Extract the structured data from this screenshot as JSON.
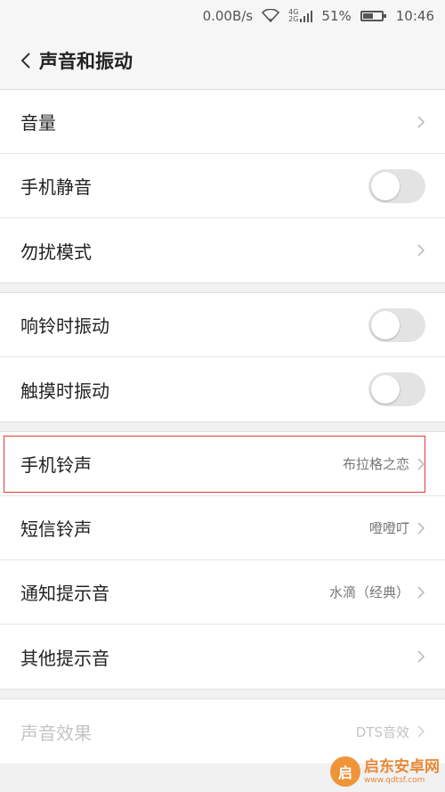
{
  "statusbar": {
    "speed": "0.00B/s",
    "net_top": "4G",
    "net_bottom": "2G",
    "battery_level": "51%",
    "battery_fraction": 0.51,
    "time": "10:46"
  },
  "header": {
    "title": "声音和振动"
  },
  "groups": [
    {
      "items": [
        {
          "label": "音量",
          "type": "chevron"
        },
        {
          "label": "手机静音",
          "type": "toggle",
          "on": false
        },
        {
          "label": "勿扰模式",
          "type": "chevron"
        }
      ]
    },
    {
      "items": [
        {
          "label": "响铃时振动",
          "type": "toggle",
          "on": false
        },
        {
          "label": "触摸时振动",
          "type": "toggle",
          "on": false
        }
      ]
    },
    {
      "items": [
        {
          "label": "手机铃声",
          "value": "布拉格之恋",
          "type": "chevron"
        },
        {
          "label": "短信铃声",
          "value": "噔噔叮",
          "type": "chevron"
        },
        {
          "label": "通知提示音",
          "value": "水滴（经典）",
          "type": "chevron"
        },
        {
          "label": "其他提示音",
          "type": "chevron"
        }
      ]
    },
    {
      "items": [
        {
          "label": "声音效果",
          "value": "DTS音效",
          "type": "chevron",
          "disabled": true
        }
      ]
    }
  ],
  "watermark": {
    "name": "启东安卓网",
    "url": "www.qdtsf.com",
    "logo_char": "启"
  },
  "colors": {
    "highlight": "#e53935",
    "watermark": "#e67e22"
  }
}
